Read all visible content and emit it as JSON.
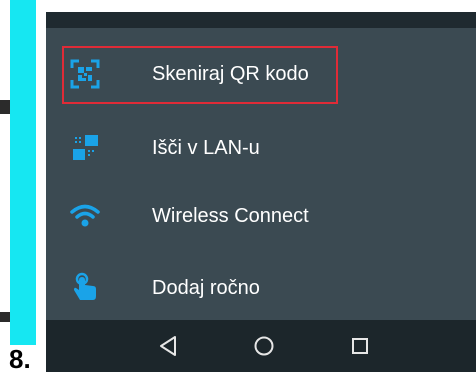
{
  "step": {
    "label": "8."
  },
  "menu": {
    "items": [
      {
        "label": "Skeniraj QR kodo",
        "icon": "qr-scan-icon",
        "selected": true
      },
      {
        "label": "Išči v LAN-u",
        "icon": "lan-search-icon"
      },
      {
        "label": "Wireless Connect",
        "icon": "wifi-icon"
      },
      {
        "label": "Dodaj ročno",
        "icon": "hand-tap-icon"
      }
    ]
  },
  "navigation": {
    "buttons": [
      {
        "icon": "back-triangle-icon"
      },
      {
        "icon": "home-circle-icon"
      },
      {
        "icon": "recent-apps-square-icon"
      }
    ]
  },
  "colors": {
    "accent_cyan": "#16e7f2",
    "icon_blue": "#1aa3e8",
    "screen_bg": "#3b4a52",
    "highlight_red": "#e02b37"
  }
}
